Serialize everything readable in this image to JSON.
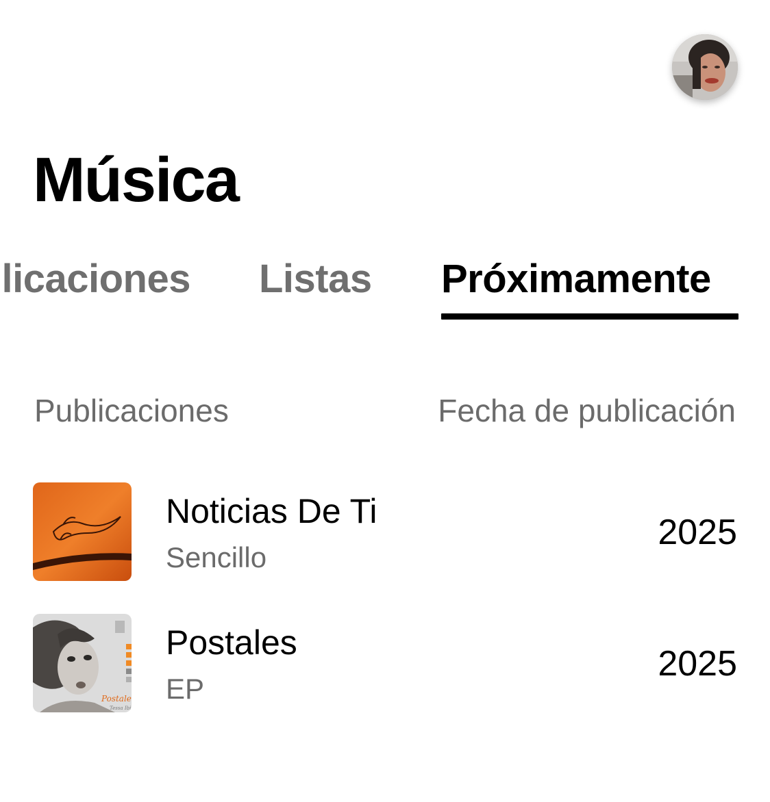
{
  "header": {
    "avatar_icon": "profile-photo-avatar",
    "title": "Música"
  },
  "tabs": [
    {
      "label": "Publicaciones",
      "visible_text": "licaciones",
      "active": false
    },
    {
      "label": "Listas",
      "active": false
    },
    {
      "label": "Próximamente",
      "active": true
    }
  ],
  "table": {
    "columns": [
      "Publicaciones",
      "Fecha de publicación"
    ],
    "rows": [
      {
        "title": "Noticias De Ti",
        "type": "Sencillo",
        "year": "2025",
        "art": "orange-tattoo-cover"
      },
      {
        "title": "Postales",
        "type": "EP",
        "year": "2025",
        "art": "postales-cover"
      }
    ]
  },
  "colors": {
    "active": "#000000",
    "inactive": "#6f6f6f",
    "secondary_text": "#6b6b6b",
    "background": "#ffffff"
  }
}
